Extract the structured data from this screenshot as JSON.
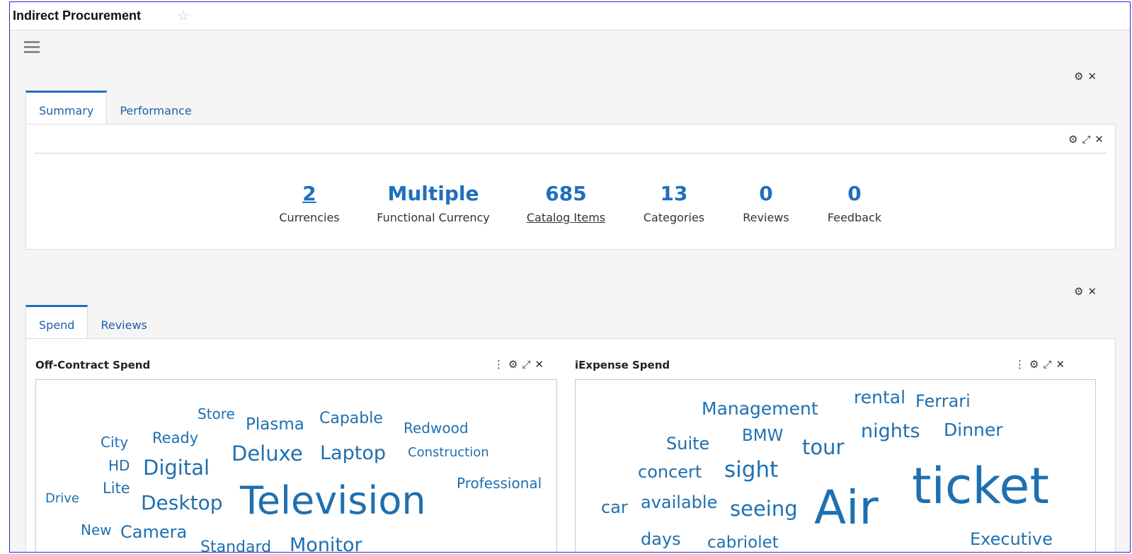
{
  "header": {
    "title": "Indirect Procurement",
    "star_glyph": "☆"
  },
  "controls": {
    "gear": "⚙",
    "expand": "⤢",
    "close": "✕",
    "kebab": "⋮"
  },
  "top_tabs": [
    {
      "label": "Summary",
      "active": true
    },
    {
      "label": "Performance",
      "active": false
    }
  ],
  "summary": {
    "stats": [
      {
        "value": "2",
        "label": "Currencies"
      },
      {
        "value": "Multiple",
        "label": "Functional Currency"
      },
      {
        "value": "685",
        "label": "Catalog Items"
      },
      {
        "value": "13",
        "label": "Categories"
      },
      {
        "value": "0",
        "label": "Reviews"
      },
      {
        "value": "0",
        "label": "Feedback"
      }
    ]
  },
  "bottom_tabs": [
    {
      "label": "Spend",
      "active": true
    },
    {
      "label": "Reviews",
      "active": false
    }
  ],
  "off_contract": {
    "title": "Off-Contract Spend",
    "words": [
      "Store",
      "Plasma",
      "Capable",
      "Redwood",
      "City",
      "Ready",
      "Deluxe",
      "Laptop",
      "Construction",
      "HD",
      "Digital",
      "Professional",
      "Lite",
      "Drive",
      "Desktop",
      "Television",
      "New",
      "Camera",
      "Standard",
      "Monitor"
    ]
  },
  "iexpense": {
    "title": "iExpense Spend",
    "words": [
      "Management",
      "rental",
      "Ferrari",
      "Suite",
      "BMW",
      "tour",
      "nights",
      "Dinner",
      "concert",
      "sight",
      "car",
      "available",
      "seeing",
      "Air",
      "ticket",
      "days",
      "cabriolet",
      "Executive"
    ]
  },
  "colors": {
    "accent": "#1f6fbf",
    "word": "#1f70b0",
    "frame": "#2b2bd6"
  }
}
